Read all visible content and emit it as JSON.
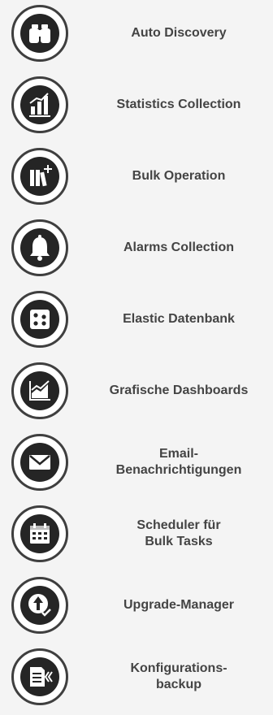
{
  "features": [
    {
      "label": "Auto Discovery",
      "icon": "binoculars-icon"
    },
    {
      "label": "Statistics Collection",
      "icon": "statistics-chart-icon"
    },
    {
      "label": "Bulk Operation",
      "icon": "bulk-books-icon"
    },
    {
      "label": "Alarms Collection",
      "icon": "bell-icon"
    },
    {
      "label": "Elastic Datenbank",
      "icon": "database-dots-icon"
    },
    {
      "label": "Grafische Dashboards",
      "icon": "area-chart-icon"
    },
    {
      "label": "Email-\nBenachrichtigungen",
      "icon": "envelope-icon"
    },
    {
      "label": "Scheduler für\nBulk Tasks",
      "icon": "calendar-icon"
    },
    {
      "label": "Upgrade-Manager",
      "icon": "upgrade-arrow-icon"
    },
    {
      "label": "Konfigurations-\nbackup",
      "icon": "config-backup-icon"
    }
  ]
}
